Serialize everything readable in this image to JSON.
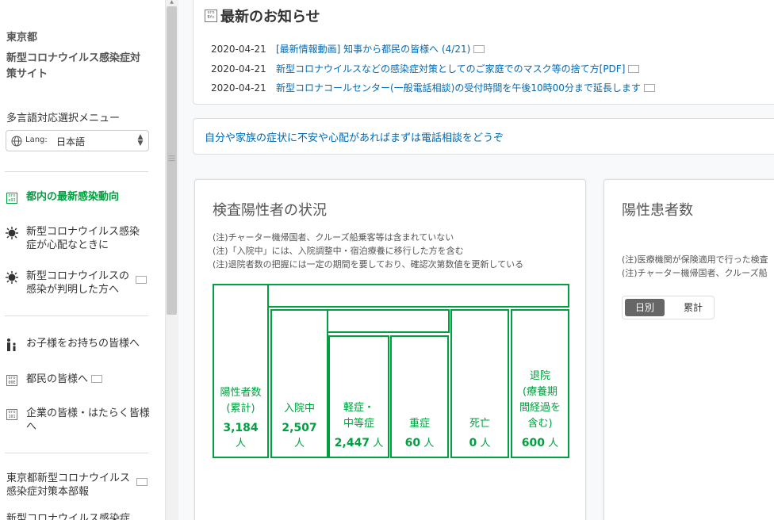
{
  "sidebar": {
    "org": "東京都",
    "site_title": "新型コロナウイルス感染症対策サイト",
    "lang_menu_label": "多言語対応選択メニュー",
    "lang_prefix": "Lang:",
    "lang_value": "日本語",
    "items": [
      {
        "label": "都内の最新感染動向",
        "icon": "chart-icon"
      },
      {
        "label": "新型コロナウイルス感染症が心配なときに",
        "icon": "virus-icon"
      },
      {
        "label": "新型コロナウイルスの感染が判明した方へ",
        "icon": "virus-icon"
      },
      {
        "label": "お子様をお持ちの皆様へ",
        "icon": "parent-child-icon"
      },
      {
        "label": "都民の皆様へ",
        "icon": "document-icon"
      },
      {
        "label": "企業の皆様・はたらく皆様へ",
        "icon": "document-icon"
      },
      {
        "label": "東京都新型コロナウイルス感染症対策本部報",
        "icon": "external-link-icon"
      },
      {
        "label": "新型コロナウイルス感染症",
        "icon": ""
      }
    ]
  },
  "news": {
    "heading": "最新のお知らせ",
    "items": [
      {
        "date": "2020-04-21",
        "text": "[最新情報動画] 知事から都民の皆様へ (4/21)"
      },
      {
        "date": "2020-04-21",
        "text": "新型コロナウイルスなどの感染症対策としてのご家庭でのマスク等の捨て方[PDF]"
      },
      {
        "date": "2020-04-21",
        "text": "新型コロナコールセンター(一般電話相談)の受付時間を午後10時00分まで延長します"
      }
    ]
  },
  "advice_link": "自分や家族の症状に不安や心配があればまずは電話相談をどうぞ",
  "status_card": {
    "title": "検査陽性者の状況",
    "notes": [
      "(注)チャーター機帰国者、クルーズ船乗客等は含まれていない",
      "(注)「入院中」には、入院調整中・宿泊療養に移行した方を含む",
      "(注)退院者数の把握には一定の期間を要しており、確認次第数値を更新している"
    ],
    "cols": [
      {
        "label": "陽性者数(累計)",
        "value": "3,184",
        "unit": "人"
      },
      {
        "label": "入院中",
        "value": "2,507",
        "unit": "人"
      },
      {
        "label": "軽症・中等症",
        "value": "2,447",
        "unit": "人"
      },
      {
        "label": "重症",
        "value": "60",
        "unit": "人"
      },
      {
        "label": "死亡",
        "value": "0",
        "unit": "人"
      },
      {
        "label": "退院(療養期間経過を含む)",
        "value": "600",
        "unit": "人"
      }
    ],
    "labels": {
      "c0a": "陽性者数",
      "c0b": "(累計)",
      "c1a": "入院中",
      "c2a": "軽症・",
      "c2b": "中等症",
      "c3a": "重症",
      "c4a": "死亡",
      "c5a": "退院",
      "c5b": "(療養期",
      "c5c": "間経過を",
      "c5d": "含む)"
    }
  },
  "patients_card": {
    "title": "陽性患者数",
    "notes": [
      "(注)医療機関が保険適用で行った検査",
      "(注)チャーター機帰国者、クルーズ船"
    ],
    "toggle": {
      "daily": "日別",
      "cumulative": "累計"
    }
  },
  "colors": {
    "accent": "#00a040",
    "link": "#006ab5"
  }
}
